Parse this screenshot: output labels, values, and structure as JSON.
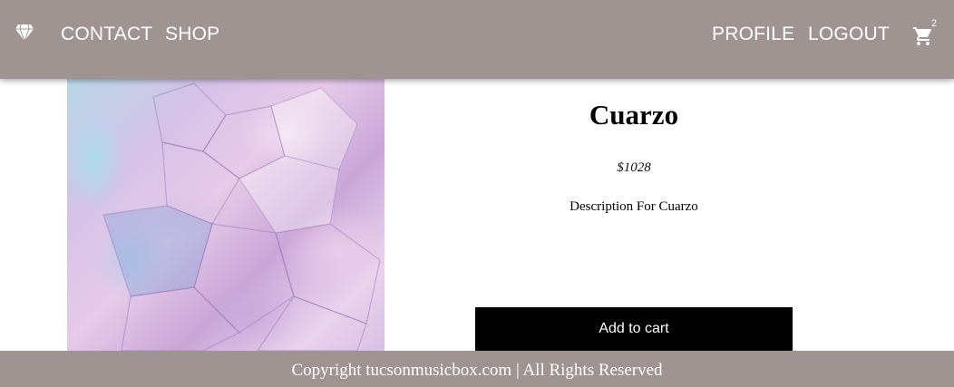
{
  "navbar": {
    "logo_icon": "diamond-icon",
    "links": {
      "contact": "CONTACT",
      "shop": "SHOP",
      "profile": "PROFILE",
      "logout": "LOGOUT"
    },
    "cart": {
      "icon": "shopping-cart-icon",
      "count": "2"
    },
    "background_color": "#a09492"
  },
  "product": {
    "title": "Cuarzo",
    "price": "$1028",
    "description": "Description For Cuarzo",
    "add_to_cart_label": "Add to cart"
  },
  "footer": {
    "text": "Copyright tucsonmusicbox.com | All Rights Reserved"
  }
}
